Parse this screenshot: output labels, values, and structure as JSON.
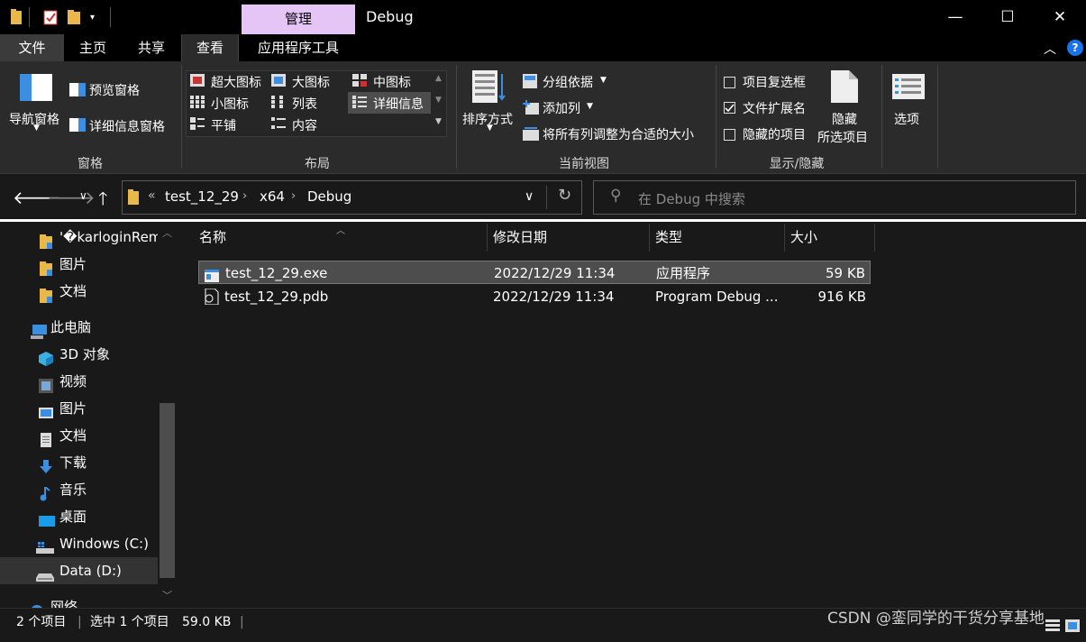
{
  "titlebar": {
    "context_tab": "管理",
    "title": "Debug",
    "minimize": "—",
    "maximize": "☐",
    "close": "✕"
  },
  "tabs": {
    "file": "文件",
    "home": "主页",
    "share": "共享",
    "view": "查看",
    "app_tools": "应用程序工具"
  },
  "ribbon": {
    "panes": {
      "nav_pane": "导航窗格",
      "preview_pane": "预览窗格",
      "details_pane": "详细信息窗格",
      "group": "窗格"
    },
    "layout": {
      "extra_large": "超大图标",
      "large": "大图标",
      "medium": "中图标",
      "small": "小图标",
      "list": "列表",
      "details": "详细信息",
      "tiles": "平铺",
      "content": "内容",
      "group": "布局"
    },
    "current_view": {
      "sort_by": "排序方式",
      "group_by": "分组依据",
      "add_column": "添加列",
      "fit_columns": "将所有列调整为合适的大小",
      "group": "当前视图"
    },
    "show_hide": {
      "item_checkboxes": "项目复选框",
      "file_extensions": "文件扩展名",
      "hidden_items": "隐藏的项目",
      "hide_selected_1": "隐藏",
      "hide_selected_2": "所选项目",
      "group": "显示/隐藏"
    },
    "options": "选项"
  },
  "address": {
    "overflow": "«",
    "crumbs": [
      "test_12_29",
      "x64",
      "Debug"
    ]
  },
  "search": {
    "placeholder": "在 Debug 中搜索"
  },
  "nav": {
    "items": [
      {
        "label": "'�karloginRemote",
        "icon": "folder-icon"
      },
      {
        "label": "图片",
        "icon": "folder-icon"
      },
      {
        "label": "文档",
        "icon": "folder-icon"
      },
      {
        "label": "此电脑",
        "icon": "computer-icon"
      },
      {
        "label": "3D 对象",
        "icon": "3d-objects-icon"
      },
      {
        "label": "视频",
        "icon": "video-icon"
      },
      {
        "label": "图片",
        "icon": "pictures-icon"
      },
      {
        "label": "文档",
        "icon": "documents-icon"
      },
      {
        "label": "下载",
        "icon": "download-icon"
      },
      {
        "label": "音乐",
        "icon": "music-icon"
      },
      {
        "label": "桌面",
        "icon": "desktop-icon"
      },
      {
        "label": "Windows (C:)",
        "icon": "drive-c-icon"
      },
      {
        "label": "Data (D:)",
        "icon": "drive-d-icon"
      },
      {
        "label": "网络",
        "icon": "network-icon"
      }
    ]
  },
  "columns": {
    "name": "名称",
    "date": "修改日期",
    "type": "类型",
    "size": "大小"
  },
  "files": [
    {
      "name": "test_12_29.exe",
      "date": "2022/12/29 11:34",
      "type": "应用程序",
      "size": "59 KB",
      "selected": true
    },
    {
      "name": "test_12_29.pdb",
      "date": "2022/12/29 11:34",
      "type": "Program Debug ...",
      "size": "916 KB",
      "selected": false
    }
  ],
  "status": {
    "count": "2 个项目",
    "selected": "选中 1 个项目",
    "size": "59.0 KB"
  },
  "watermark": "CSDN @銮同学的干货分享基地",
  "colors": {
    "accent": "#0078d7",
    "context_tab": "#e5c5f5",
    "selected_row": "#4d4d4d",
    "background": "#191919",
    "ribbon": "#2b2b2b"
  }
}
